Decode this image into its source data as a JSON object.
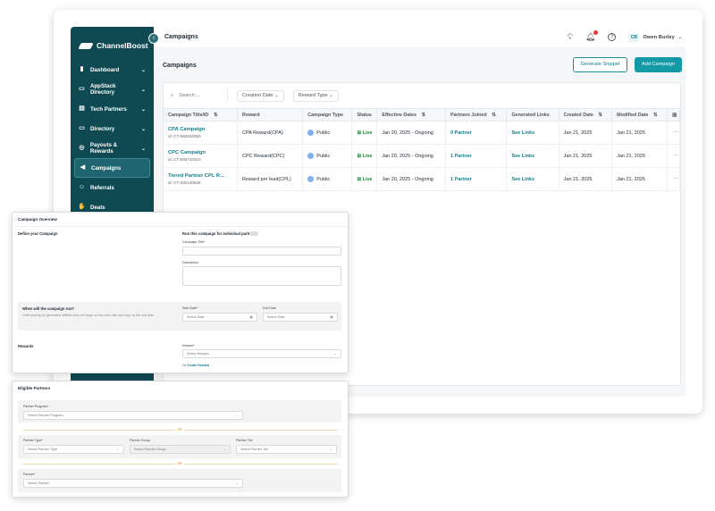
{
  "sidebar": {
    "brand": "ChannelBoost",
    "items": [
      {
        "label": "Dashboard",
        "icon": "chart-icon",
        "chevron": true
      },
      {
        "label": "AppStack Directory",
        "icon": "folder-icon",
        "chevron": true
      },
      {
        "label": "Tech Partners",
        "icon": "briefcase-icon",
        "chevron": true
      },
      {
        "label": "Directory",
        "icon": "folder-icon",
        "chevron": true
      },
      {
        "label": "Payouts & Rewards",
        "icon": "coin-icon",
        "chevron": true
      },
      {
        "label": "Campaigns",
        "icon": "megaphone-icon",
        "chevron": false,
        "active": true
      },
      {
        "label": "Referrals",
        "icon": "users-icon",
        "chevron": false
      },
      {
        "label": "Deals",
        "icon": "handshake-icon",
        "chevron": false
      }
    ]
  },
  "topbar": {
    "title": "Campaigns",
    "user_initials": "CB",
    "user_name": "Owen Burley"
  },
  "main": {
    "heading": "Campaigns",
    "generate_snippet": "Generate Snippet",
    "add_campaign": "Add Campaign",
    "search_placeholder": "Search ...",
    "filter_creation_date": "Creation Date",
    "filter_reward_type": "Reward Type",
    "columns": [
      "Campaign Title/ID",
      "Reward",
      "Campaign Type",
      "Status",
      "Effective Dates",
      "Partners Joined",
      "Generated Links",
      "Created Date",
      "Modified Date"
    ],
    "rows": [
      {
        "title": "CPA Campaign",
        "id": "id: CT-662634050",
        "reward": "CPA Reward(CPA)",
        "type": "Public",
        "status": "Live",
        "dates": "Jan 20, 2025 - Ongoing",
        "partners": "0 Partner",
        "links": "See Links",
        "created": "Jan 21, 2025",
        "modified": "Jan 21, 2025"
      },
      {
        "title": "CPC Campaign",
        "id": "id: CT-505710310",
        "reward": "CPC Reward(CPC)",
        "type": "Public",
        "status": "Live",
        "dates": "Jan 20, 2025 - Ongoing",
        "partners": "1 Partner",
        "links": "See Links",
        "created": "Jan 21, 2025",
        "modified": "Jan 21, 2025"
      },
      {
        "title": "Tiered Partner CPL R...",
        "id": "id: CT-330140546",
        "reward": "Reward per lead(CPL)",
        "type": "Public",
        "status": "Live",
        "dates": "Jan 20, 2025 - Ongoing",
        "partners": "1 Partner",
        "links": "See Links",
        "created": "Jan 21, 2025",
        "modified": "Jan 21, 2025"
      }
    ]
  },
  "overview": {
    "title": "Campaign Overview",
    "define": "Define your Campaign",
    "individual_toggle": "Run this campaign for individual partner",
    "campaign_title_label": "Campaign Title*",
    "description_label": "Description",
    "when_label": "When will the campaign run?",
    "when_help": "Until tracking for generated affiliate links will begin on the start date and stop on the end date",
    "start_label": "Start Date*",
    "end_label": "End Date",
    "select_date": "Select Date",
    "rewards_label": "Rewards",
    "reward_field_label": "Reward*",
    "select_reward": "Select Reward",
    "or": "Or",
    "create_reward": "Create Reward"
  },
  "eligible": {
    "title": "Eligible Partners",
    "program_label": "Partner Program*",
    "program_placeholder": "Select Partner Program",
    "or": "OR",
    "type_label": "Partner Type*",
    "type_placeholder": "Select Partner Type",
    "group_label": "Partner Group",
    "group_placeholder": "Select Partner Group",
    "tier_label": "Partner Tier",
    "tier_placeholder": "Select Partner Tier",
    "partner_label": "Partner*",
    "partner_placeholder": "Select Partner"
  },
  "colors": {
    "sidebar": "#0f4a53",
    "accent": "#139aa6",
    "live": "#1d8a3a",
    "or": "#e08a00"
  }
}
